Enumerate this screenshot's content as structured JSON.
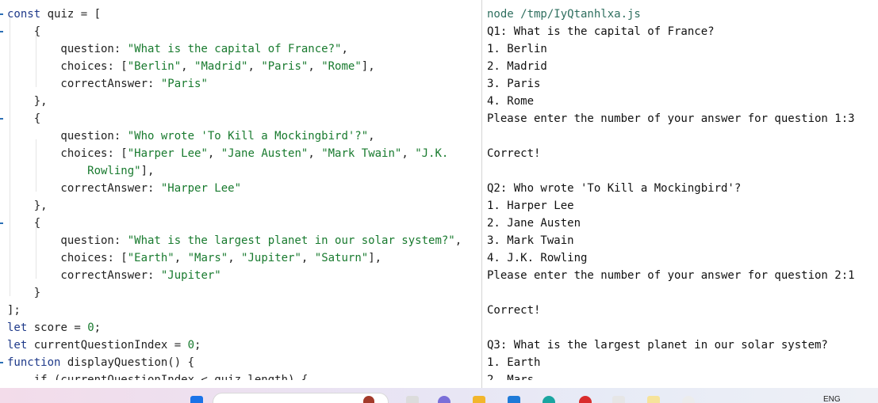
{
  "editor": {
    "lines": [
      [
        {
          "t": "const",
          "c": "kw"
        },
        {
          "t": " quiz "
        },
        {
          "t": "=",
          "c": "punct"
        },
        {
          "t": " ["
        }
      ],
      [
        {
          "t": "    {"
        }
      ],
      [
        {
          "t": "        question"
        },
        {
          "t": ": "
        },
        {
          "t": "\"What is the capital of France?\"",
          "c": "str"
        },
        {
          "t": ","
        }
      ],
      [
        {
          "t": "        choices"
        },
        {
          "t": ": ["
        },
        {
          "t": "\"Berlin\"",
          "c": "str"
        },
        {
          "t": ", "
        },
        {
          "t": "\"Madrid\"",
          "c": "str"
        },
        {
          "t": ", "
        },
        {
          "t": "\"Paris\"",
          "c": "str"
        },
        {
          "t": ", "
        },
        {
          "t": "\"Rome\"",
          "c": "str"
        },
        {
          "t": "],"
        }
      ],
      [
        {
          "t": "        correctAnswer"
        },
        {
          "t": ": "
        },
        {
          "t": "\"Paris\"",
          "c": "str"
        }
      ],
      [
        {
          "t": "    },"
        }
      ],
      [
        {
          "t": "    {"
        }
      ],
      [
        {
          "t": "        question"
        },
        {
          "t": ": "
        },
        {
          "t": "\"Who wrote 'To Kill a Mockingbird'?\"",
          "c": "str"
        },
        {
          "t": ","
        }
      ],
      [
        {
          "t": "        choices"
        },
        {
          "t": ": ["
        },
        {
          "t": "\"Harper Lee\"",
          "c": "str"
        },
        {
          "t": ", "
        },
        {
          "t": "\"Jane Austen\"",
          "c": "str"
        },
        {
          "t": ", "
        },
        {
          "t": "\"Mark Twain\"",
          "c": "str"
        },
        {
          "t": ", "
        },
        {
          "t": "\"J.K.",
          "c": "str"
        }
      ],
      [
        {
          "t": "            Rowling\"",
          "c": "str"
        },
        {
          "t": "],"
        }
      ],
      [
        {
          "t": "        correctAnswer"
        },
        {
          "t": ": "
        },
        {
          "t": "\"Harper Lee\"",
          "c": "str"
        }
      ],
      [
        {
          "t": "    },"
        }
      ],
      [
        {
          "t": "    {"
        }
      ],
      [
        {
          "t": "        question"
        },
        {
          "t": ": "
        },
        {
          "t": "\"What is the largest planet in our solar system?\"",
          "c": "str"
        },
        {
          "t": ","
        }
      ],
      [
        {
          "t": "        choices"
        },
        {
          "t": ": ["
        },
        {
          "t": "\"Earth\"",
          "c": "str"
        },
        {
          "t": ", "
        },
        {
          "t": "\"Mars\"",
          "c": "str"
        },
        {
          "t": ", "
        },
        {
          "t": "\"Jupiter\"",
          "c": "str"
        },
        {
          "t": ", "
        },
        {
          "t": "\"Saturn\"",
          "c": "str"
        },
        {
          "t": "],"
        }
      ],
      [
        {
          "t": "        correctAnswer"
        },
        {
          "t": ": "
        },
        {
          "t": "\"Jupiter\"",
          "c": "str"
        }
      ],
      [
        {
          "t": "    }"
        }
      ],
      [
        {
          "t": "];"
        }
      ],
      [
        {
          "t": "let",
          "c": "kw"
        },
        {
          "t": " score "
        },
        {
          "t": "=",
          "c": "punct"
        },
        {
          "t": " "
        },
        {
          "t": "0",
          "c": "num"
        },
        {
          "t": ";"
        }
      ],
      [
        {
          "t": "let",
          "c": "kw"
        },
        {
          "t": " currentQuestionIndex "
        },
        {
          "t": "=",
          "c": "punct"
        },
        {
          "t": " "
        },
        {
          "t": "0",
          "c": "num"
        },
        {
          "t": ";"
        }
      ],
      [
        {
          "t": "function",
          "c": "kw"
        },
        {
          "t": " displayQuestion() {"
        }
      ],
      [
        {
          "t": "    if (currentQuestionIndex < quiz.length) {"
        }
      ]
    ]
  },
  "output": {
    "command": "node /tmp/IyQtanhlxa.js",
    "lines": [
      "Q1: What is the capital of France?",
      "1. Berlin",
      "2. Madrid",
      "3. Paris",
      "4. Rome",
      "Please enter the number of your answer for question 1:3",
      "",
      "Correct!",
      "",
      "Q2: Who wrote 'To Kill a Mockingbird'?",
      "1. Harper Lee",
      "2. Jane Austen",
      "3. Mark Twain",
      "4. J.K. Rowling",
      "Please enter the number of your answer for question 2:1",
      "",
      "Correct!",
      "",
      "Q3: What is the largest planet in our solar system?",
      "1. Earth",
      "2. Mars"
    ]
  },
  "taskbar": {
    "language": "ENG",
    "icons": [
      "windows-start-icon",
      "search-box",
      "app-icon-1",
      "app-icon-2",
      "file-explorer-icon",
      "store-icon",
      "edge-icon",
      "chrome-icon",
      "app-icon-3",
      "app-icon-4",
      "app-icon-5",
      "app-icon-6"
    ]
  },
  "colors": {
    "keyword": "#1f3a8a",
    "string": "#187a2e",
    "command": "#2f6f5f",
    "gutter_marker": "#2b6fb5"
  }
}
